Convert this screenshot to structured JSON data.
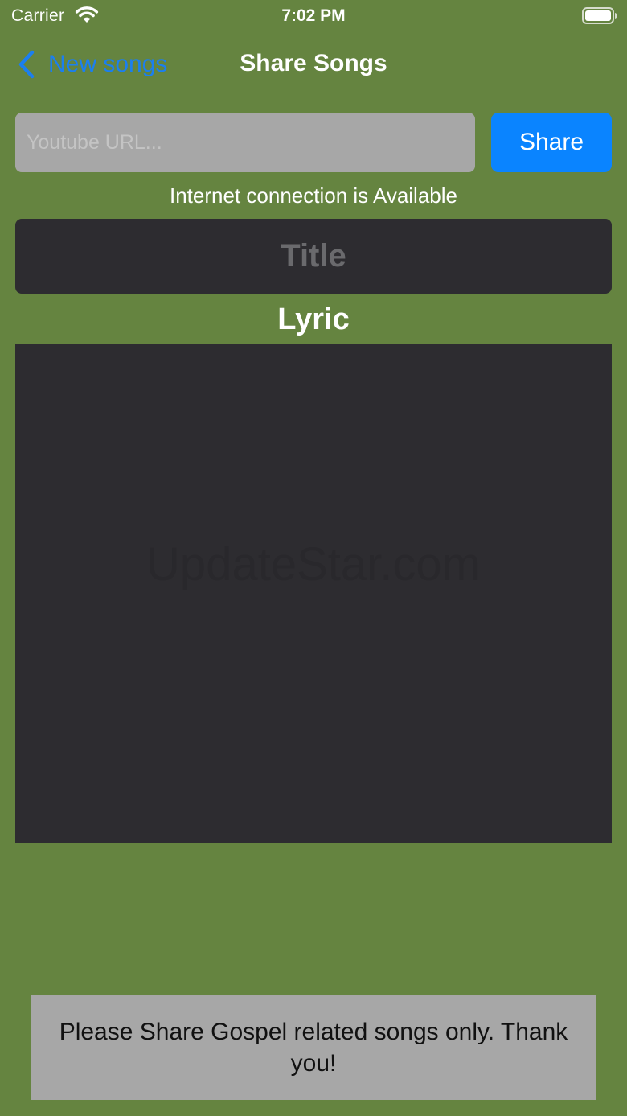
{
  "status_bar": {
    "carrier": "Carrier",
    "time": "7:02 PM",
    "wifi_icon": "wifi-icon",
    "battery_icon": "battery-icon"
  },
  "nav": {
    "back_label": "New songs",
    "back_icon": "chevron-left-icon",
    "title": "Share Songs"
  },
  "url_field": {
    "placeholder": "Youtube URL...",
    "value": ""
  },
  "share_button": {
    "label": "Share"
  },
  "connection_status": "Internet connection is Available",
  "title_field": {
    "placeholder": "Title",
    "value": ""
  },
  "lyric": {
    "label": "Lyric",
    "value": ""
  },
  "watermark": "UpdateStar.com",
  "notice": "Please Share Gospel related songs only. Thank you!",
  "colors": {
    "background": "#658440",
    "accent": "#0a84ff",
    "field_dark": "#2d2c30",
    "field_gray": "#a7a7a7"
  }
}
